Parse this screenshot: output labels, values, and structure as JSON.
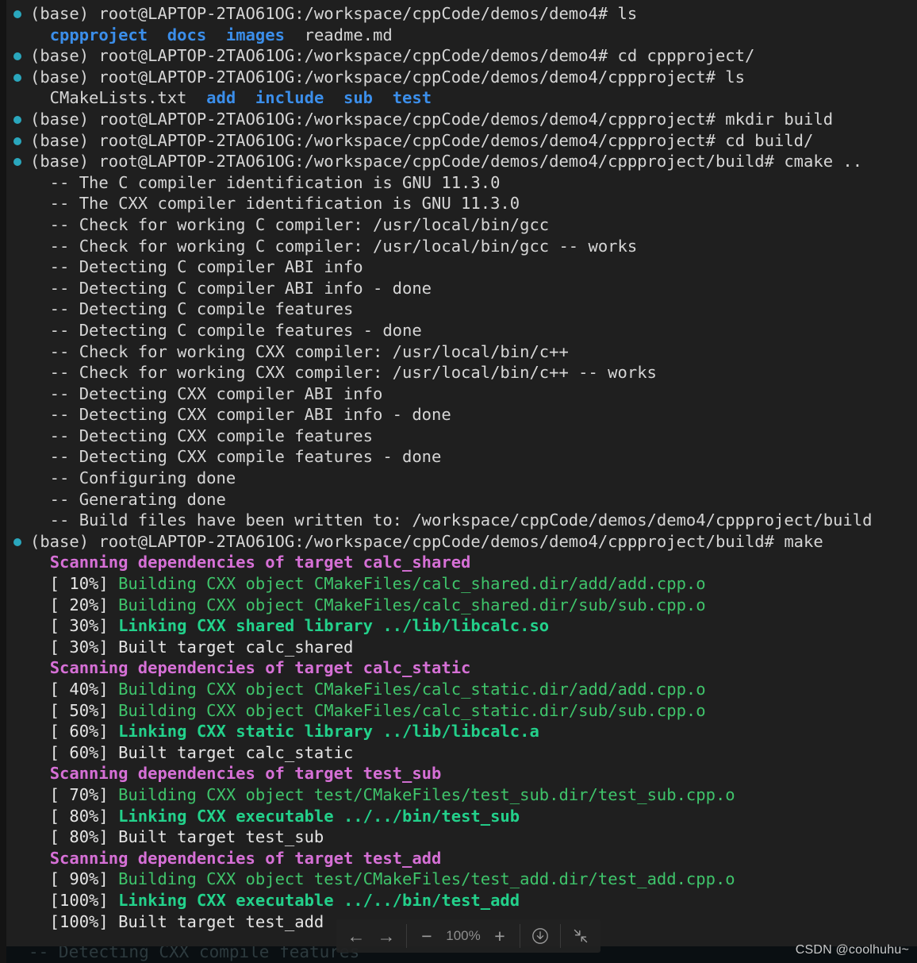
{
  "terminal": {
    "prompt_user": "(base) root@LAPTOP-2TAO61OG:",
    "lines": [
      {
        "kind": "prompt",
        "bullet": true,
        "segments": [
          {
            "text": "(base) root@LAPTOP-2TAO61OG:/workspace/cppCode/demos/demo4# ls",
            "style": "default"
          }
        ]
      },
      {
        "kind": "output",
        "bullet": false,
        "segments": [
          {
            "text": "  ",
            "style": "default"
          },
          {
            "text": "cppproject",
            "style": "dir"
          },
          {
            "text": "  ",
            "style": "default"
          },
          {
            "text": "docs",
            "style": "dir"
          },
          {
            "text": "  ",
            "style": "default"
          },
          {
            "text": "images",
            "style": "dir"
          },
          {
            "text": "  readme.md",
            "style": "default"
          }
        ]
      },
      {
        "kind": "prompt",
        "bullet": true,
        "segments": [
          {
            "text": "(base) root@LAPTOP-2TAO61OG:/workspace/cppCode/demos/demo4# cd cppproject/",
            "style": "default"
          }
        ]
      },
      {
        "kind": "prompt",
        "bullet": true,
        "segments": [
          {
            "text": "(base) root@LAPTOP-2TAO61OG:/workspace/cppCode/demos/demo4/cppproject# ls",
            "style": "default"
          }
        ]
      },
      {
        "kind": "output",
        "bullet": false,
        "segments": [
          {
            "text": "  CMakeLists.txt  ",
            "style": "default"
          },
          {
            "text": "add",
            "style": "dir"
          },
          {
            "text": "  ",
            "style": "default"
          },
          {
            "text": "include",
            "style": "dir"
          },
          {
            "text": "  ",
            "style": "default"
          },
          {
            "text": "sub",
            "style": "dir"
          },
          {
            "text": "  ",
            "style": "default"
          },
          {
            "text": "test",
            "style": "dir"
          }
        ]
      },
      {
        "kind": "prompt",
        "bullet": true,
        "segments": [
          {
            "text": "(base) root@LAPTOP-2TAO61OG:/workspace/cppCode/demos/demo4/cppproject# mkdir build",
            "style": "default"
          }
        ]
      },
      {
        "kind": "prompt",
        "bullet": true,
        "segments": [
          {
            "text": "(base) root@LAPTOP-2TAO61OG:/workspace/cppCode/demos/demo4/cppproject# cd build/",
            "style": "default"
          }
        ]
      },
      {
        "kind": "prompt",
        "bullet": true,
        "segments": [
          {
            "text": "(base) root@LAPTOP-2TAO61OG:/workspace/cppCode/demos/demo4/cppproject/build# cmake ..",
            "style": "default"
          }
        ]
      },
      {
        "kind": "output",
        "bullet": false,
        "segments": [
          {
            "text": "  -- The C compiler identification is GNU 11.3.0",
            "style": "default"
          }
        ]
      },
      {
        "kind": "output",
        "bullet": false,
        "segments": [
          {
            "text": "  -- The CXX compiler identification is GNU 11.3.0",
            "style": "default"
          }
        ]
      },
      {
        "kind": "output",
        "bullet": false,
        "segments": [
          {
            "text": "  -- Check for working C compiler: /usr/local/bin/gcc",
            "style": "default"
          }
        ]
      },
      {
        "kind": "output",
        "bullet": false,
        "segments": [
          {
            "text": "  -- Check for working C compiler: /usr/local/bin/gcc -- works",
            "style": "default"
          }
        ]
      },
      {
        "kind": "output",
        "bullet": false,
        "segments": [
          {
            "text": "  -- Detecting C compiler ABI info",
            "style": "default"
          }
        ]
      },
      {
        "kind": "output",
        "bullet": false,
        "segments": [
          {
            "text": "  -- Detecting C compiler ABI info - done",
            "style": "default"
          }
        ]
      },
      {
        "kind": "output",
        "bullet": false,
        "segments": [
          {
            "text": "  -- Detecting C compile features",
            "style": "default"
          }
        ]
      },
      {
        "kind": "output",
        "bullet": false,
        "segments": [
          {
            "text": "  -- Detecting C compile features - done",
            "style": "default"
          }
        ]
      },
      {
        "kind": "output",
        "bullet": false,
        "segments": [
          {
            "text": "  -- Check for working CXX compiler: /usr/local/bin/c++",
            "style": "default"
          }
        ]
      },
      {
        "kind": "output",
        "bullet": false,
        "segments": [
          {
            "text": "  -- Check for working CXX compiler: /usr/local/bin/c++ -- works",
            "style": "default"
          }
        ]
      },
      {
        "kind": "output",
        "bullet": false,
        "segments": [
          {
            "text": "  -- Detecting CXX compiler ABI info",
            "style": "default"
          }
        ]
      },
      {
        "kind": "output",
        "bullet": false,
        "segments": [
          {
            "text": "  -- Detecting CXX compiler ABI info - done",
            "style": "default"
          }
        ]
      },
      {
        "kind": "output",
        "bullet": false,
        "segments": [
          {
            "text": "  -- Detecting CXX compile features",
            "style": "default"
          }
        ]
      },
      {
        "kind": "output",
        "bullet": false,
        "segments": [
          {
            "text": "  -- Detecting CXX compile features - done",
            "style": "default"
          }
        ]
      },
      {
        "kind": "output",
        "bullet": false,
        "segments": [
          {
            "text": "  -- Configuring done",
            "style": "default"
          }
        ]
      },
      {
        "kind": "output",
        "bullet": false,
        "segments": [
          {
            "text": "  -- Generating done",
            "style": "default"
          }
        ]
      },
      {
        "kind": "output",
        "bullet": false,
        "segments": [
          {
            "text": "  -- Build files have been written to: /workspace/cppCode/demos/demo4/cppproject/build",
            "style": "default"
          }
        ]
      },
      {
        "kind": "prompt",
        "bullet": true,
        "segments": [
          {
            "text": "(base) root@LAPTOP-2TAO61OG:/workspace/cppCode/demos/demo4/cppproject/build# make",
            "style": "default"
          }
        ]
      },
      {
        "kind": "output",
        "bullet": false,
        "segments": [
          {
            "text": "  ",
            "style": "default"
          },
          {
            "text": "Scanning dependencies of target calc_shared",
            "style": "magenta"
          }
        ]
      },
      {
        "kind": "output",
        "bullet": false,
        "segments": [
          {
            "text": "  [ 10%] ",
            "style": "white"
          },
          {
            "text": "Building CXX object CMakeFiles/calc_shared.dir/add/add.cpp.o",
            "style": "green"
          }
        ]
      },
      {
        "kind": "output",
        "bullet": false,
        "segments": [
          {
            "text": "  [ 20%] ",
            "style": "white"
          },
          {
            "text": "Building CXX object CMakeFiles/calc_shared.dir/sub/sub.cpp.o",
            "style": "green"
          }
        ]
      },
      {
        "kind": "output",
        "bullet": false,
        "segments": [
          {
            "text": "  [ 30%] ",
            "style": "white"
          },
          {
            "text": "Linking CXX shared library ../lib/libcalc.so",
            "style": "greenb"
          }
        ]
      },
      {
        "kind": "output",
        "bullet": false,
        "segments": [
          {
            "text": "  [ 30%] Built target calc_shared",
            "style": "white"
          }
        ]
      },
      {
        "kind": "output",
        "bullet": false,
        "segments": [
          {
            "text": "  ",
            "style": "default"
          },
          {
            "text": "Scanning dependencies of target calc_static",
            "style": "magenta"
          }
        ]
      },
      {
        "kind": "output",
        "bullet": false,
        "segments": [
          {
            "text": "  [ 40%] ",
            "style": "white"
          },
          {
            "text": "Building CXX object CMakeFiles/calc_static.dir/add/add.cpp.o",
            "style": "green"
          }
        ]
      },
      {
        "kind": "output",
        "bullet": false,
        "segments": [
          {
            "text": "  [ 50%] ",
            "style": "white"
          },
          {
            "text": "Building CXX object CMakeFiles/calc_static.dir/sub/sub.cpp.o",
            "style": "green"
          }
        ]
      },
      {
        "kind": "output",
        "bullet": false,
        "segments": [
          {
            "text": "  [ 60%] ",
            "style": "white"
          },
          {
            "text": "Linking CXX static library ../lib/libcalc.a",
            "style": "greenb"
          }
        ]
      },
      {
        "kind": "output",
        "bullet": false,
        "segments": [
          {
            "text": "  [ 60%] Built target calc_static",
            "style": "white"
          }
        ]
      },
      {
        "kind": "output",
        "bullet": false,
        "segments": [
          {
            "text": "  ",
            "style": "default"
          },
          {
            "text": "Scanning dependencies of target test_sub",
            "style": "magenta"
          }
        ]
      },
      {
        "kind": "output",
        "bullet": false,
        "segments": [
          {
            "text": "  [ 70%] ",
            "style": "white"
          },
          {
            "text": "Building CXX object test/CMakeFiles/test_sub.dir/test_sub.cpp.o",
            "style": "green"
          }
        ]
      },
      {
        "kind": "output",
        "bullet": false,
        "segments": [
          {
            "text": "  [ 80%] ",
            "style": "white"
          },
          {
            "text": "Linking CXX executable ../../bin/test_sub",
            "style": "greenb"
          }
        ]
      },
      {
        "kind": "output",
        "bullet": false,
        "segments": [
          {
            "text": "  [ 80%] Built target test_sub",
            "style": "white"
          }
        ]
      },
      {
        "kind": "output",
        "bullet": false,
        "segments": [
          {
            "text": "  ",
            "style": "default"
          },
          {
            "text": "Scanning dependencies of target test_add",
            "style": "magenta"
          }
        ]
      },
      {
        "kind": "output",
        "bullet": false,
        "segments": [
          {
            "text": "  [ 90%] ",
            "style": "white"
          },
          {
            "text": "Building CXX object test/CMakeFiles/test_add.dir/test_add.cpp.o",
            "style": "green"
          }
        ]
      },
      {
        "kind": "output",
        "bullet": false,
        "segments": [
          {
            "text": "  [100%] ",
            "style": "white"
          },
          {
            "text": "Linking CXX executable ../../bin/test_add",
            "style": "greenb"
          }
        ]
      },
      {
        "kind": "output",
        "bullet": false,
        "segments": [
          {
            "text": "  [100%] Built target test_add",
            "style": "white"
          }
        ]
      }
    ]
  },
  "background_peek": {
    "text": "-- Detecting CXX compile features"
  },
  "toolbar": {
    "prev_label": "←",
    "next_label": "→",
    "zoom_out_label": "−",
    "zoom_level": "100%",
    "zoom_in_label": "+",
    "download_label": "download-icon",
    "collapse_label": "collapse-icon"
  },
  "watermark": {
    "text": "CSDN @coolhuhu~"
  },
  "colors": {
    "terminal_bg": "#1f1f1f",
    "gutter": "#141414",
    "text": "#d6d6d6",
    "dir_blue": "#3b8eea",
    "green": "#3fc46b",
    "green_bold": "#23d18b",
    "magenta": "#d670d6",
    "bullet_teal": "#2aa7bd",
    "toolbar_bg": "#222222"
  }
}
